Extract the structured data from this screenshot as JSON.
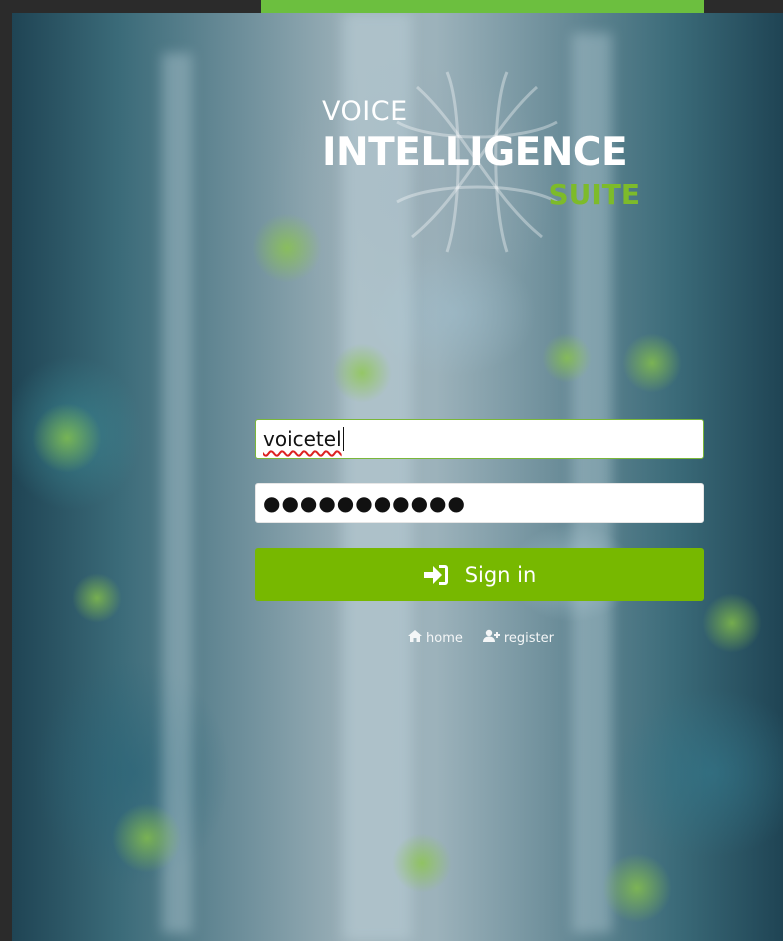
{
  "brand": {
    "line1": "VOICE",
    "line2": "INTELLIGENCE",
    "line3": "SUITE",
    "accent_color": "#77b800"
  },
  "login": {
    "username_value": "voicetel",
    "password_masked": "●●●●●●●●●●●",
    "signin_label": "Sign in",
    "signin_icon": "sign-in-icon"
  },
  "footer_links": [
    {
      "label": "home",
      "icon": "home-icon"
    },
    {
      "label": "register",
      "icon": "user-plus-icon"
    }
  ]
}
